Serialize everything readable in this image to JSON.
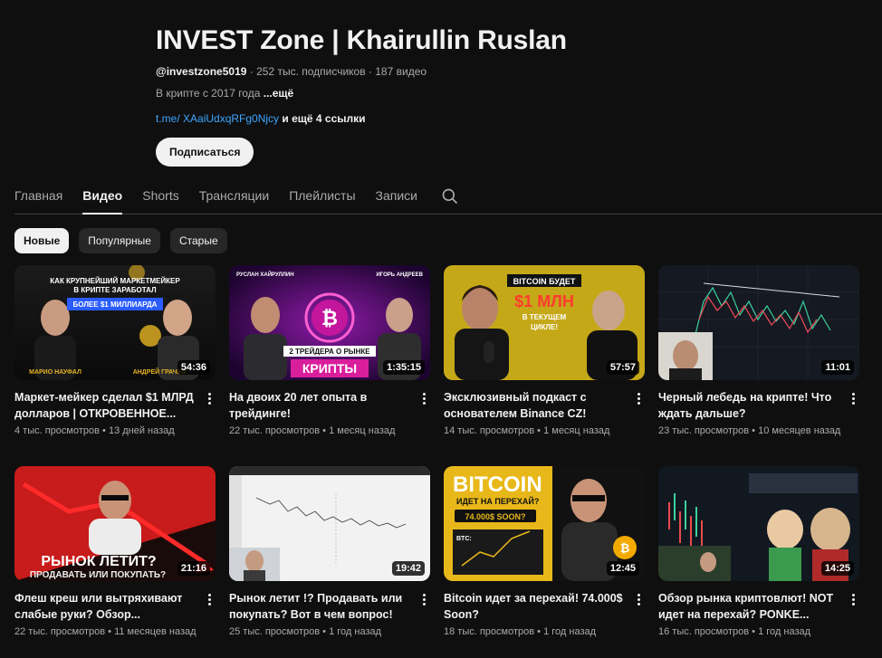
{
  "channel": {
    "title": "INVEST Zone | Khairullin Ruslan",
    "handle": "@investzone5019",
    "stats": " · 252 тыс. подписчиков · 187 видео",
    "description": "В крипте с 2017 года",
    "more": "...ещё",
    "link": "t.me/ XAaiUdxqRFg0Njcy",
    "more_links": " и ещё 4 ссылки",
    "subscribe_label": "Подписаться"
  },
  "tabs": [
    "Главная",
    "Видео",
    "Shorts",
    "Трансляции",
    "Плейлисты",
    "Записи"
  ],
  "active_tab": "Видео",
  "chips": [
    "Новые",
    "Популярные",
    "Старые"
  ],
  "active_chip": "Новые",
  "videos": [
    {
      "title": "Маркет-мейкер сделал $1 МЛРД долларов | ОТКРОВЕННОЕ...",
      "views": "4 тыс. просмотров",
      "age": "13 дней назад",
      "duration": "54:36",
      "thumb_text": [
        "КАК КРУПНЕЙШИЙ МАРКЕТМЕЙКЕР",
        "В КРИПТЕ ЗАРАБОТАЛ",
        "БОЛЕЕ $1 МИЛЛИАРДА",
        "МАРИО НАУФАЛ",
        "АНДРЕЙ ГРАЧЕВ"
      ]
    },
    {
      "title": "На двоих 20 лет опыта в трейдинге!",
      "views": "22 тыс. просмотров",
      "age": "1 месяц назад",
      "duration": "1:35:15",
      "thumb_text": [
        "РУСЛАН ХАЙРУЛЛИН",
        "ИГОРЬ АНДРЕЕВ",
        "2 ТРЕЙДЕРА О РЫНКЕ",
        "КРИПТЫ"
      ]
    },
    {
      "title": "Эксклюзивный подкаст с основателем Binance CZ!",
      "views": "14 тыс. просмотров",
      "age": "1 месяц назад",
      "duration": "57:57",
      "thumb_text": [
        "BITCOIN БУДЕТ",
        "$1 МЛН",
        "В ТЕКУЩЕМ",
        "ЦИКЛЕ!"
      ]
    },
    {
      "title": "Черный лебедь на крипте! Что ждать дальше?",
      "views": "23 тыс. просмотров",
      "age": "10 месяцев назад",
      "duration": "11:01",
      "thumb_text": []
    },
    {
      "title": "Флеш креш или вытряхивают слабые руки? Обзор...",
      "views": "22 тыс. просмотров",
      "age": "11 месяцев назад",
      "duration": "21:16",
      "thumb_text": [
        "РЫНОК ЛЕТИТ?",
        "ПРОДАВАТЬ ИЛИ ПОКУПАТЬ?"
      ]
    },
    {
      "title": "Рынок летит !? Продавать или покупать? Вот в чем вопрос!",
      "views": "25 тыс. просмотров",
      "age": "1 год назад",
      "duration": "19:42",
      "thumb_text": []
    },
    {
      "title": "Bitcoin идет за перехай! 74.000$ Soon?",
      "views": "18 тыс. просмотров",
      "age": "1 год назад",
      "duration": "12:45",
      "thumb_text": [
        "BITCOIN",
        "ИДЕТ НА ПЕРЕХАЙ?",
        "74.000$ SOON?",
        "BTC:"
      ]
    },
    {
      "title": "Обзор рынка криптовлют! NOT идет на перехай? PONKE...",
      "views": "16 тыс. просмотров",
      "age": "1 год назад",
      "duration": "14:25",
      "thumb_text": []
    }
  ]
}
